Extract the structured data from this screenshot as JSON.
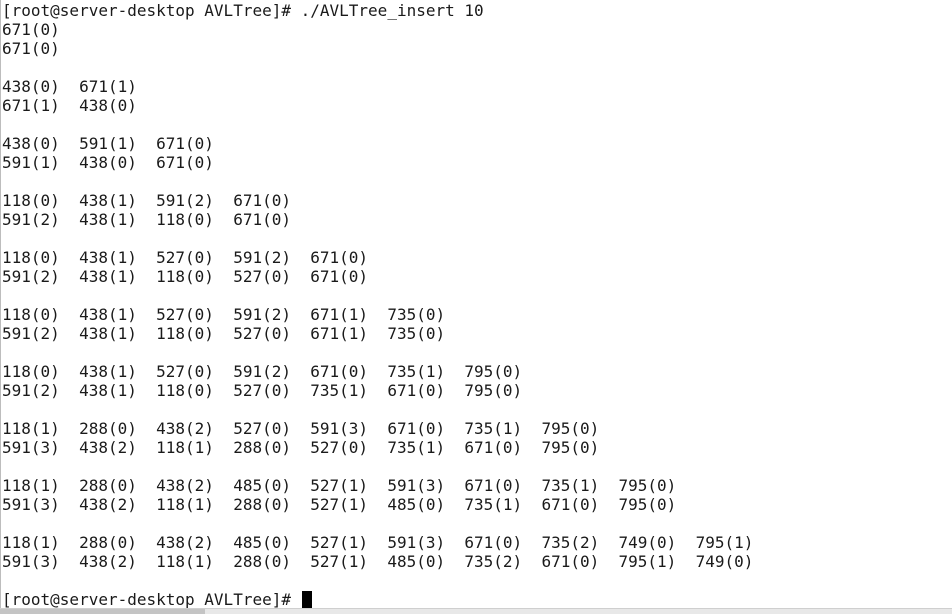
{
  "terminal": {
    "lines": [
      "[root@server-desktop AVLTree]# ./AVLTree_insert 10",
      "671(0)",
      "671(0)",
      "",
      "438(0)  671(1)",
      "671(1)  438(0)",
      "",
      "438(0)  591(1)  671(0)",
      "591(1)  438(0)  671(0)",
      "",
      "118(0)  438(1)  591(2)  671(0)",
      "591(2)  438(1)  118(0)  671(0)",
      "",
      "118(0)  438(1)  527(0)  591(2)  671(0)",
      "591(2)  438(1)  118(0)  527(0)  671(0)",
      "",
      "118(0)  438(1)  527(0)  591(2)  671(1)  735(0)",
      "591(2)  438(1)  118(0)  527(0)  671(1)  735(0)",
      "",
      "118(0)  438(1)  527(0)  591(2)  671(0)  735(1)  795(0)",
      "591(2)  438(1)  118(0)  527(0)  735(1)  671(0)  795(0)",
      "",
      "118(1)  288(0)  438(2)  527(0)  591(3)  671(0)  735(1)  795(0)",
      "591(3)  438(2)  118(1)  288(0)  527(0)  735(1)  671(0)  795(0)",
      "",
      "118(1)  288(0)  438(2)  485(0)  527(1)  591(3)  671(0)  735(1)  795(0)",
      "591(3)  438(2)  118(1)  288(0)  527(1)  485(0)  735(1)  671(0)  795(0)",
      "",
      "118(1)  288(0)  438(2)  485(0)  527(1)  591(3)  671(0)  735(2)  749(0)  795(1)",
      "591(3)  438(2)  118(1)  288(0)  527(1)  485(0)  735(2)  671(0)  795(1)  749(0)",
      ""
    ],
    "prompt": "[root@server-desktop AVLTree]# "
  },
  "colors": {
    "background": "#ffffff",
    "text": "#1a1a1a",
    "cursor": "#000000"
  }
}
